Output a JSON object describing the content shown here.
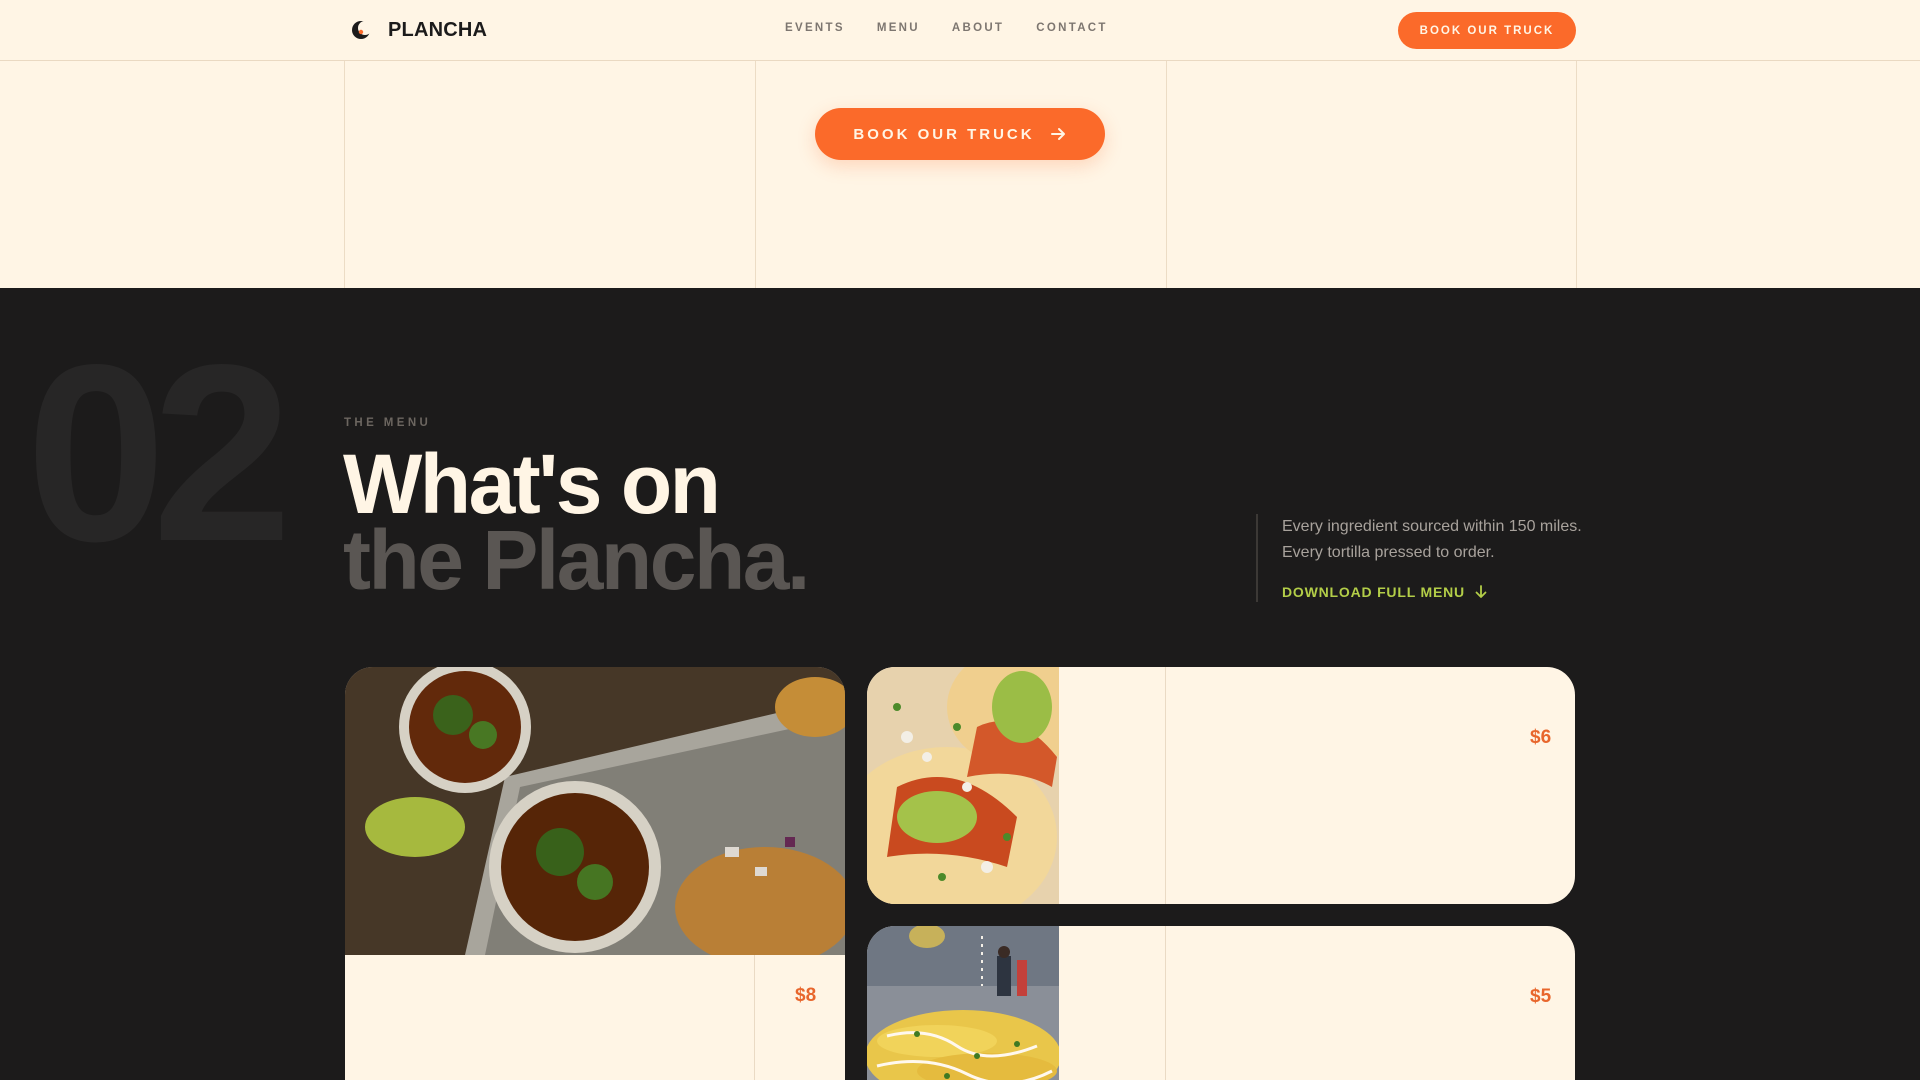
{
  "header": {
    "brand": "PLANCHA",
    "nav": [
      {
        "label": "EVENTS",
        "name": "nav-events"
      },
      {
        "label": "MENU",
        "name": "nav-menu"
      },
      {
        "label": "ABOUT",
        "name": "nav-about"
      },
      {
        "label": "CONTACT",
        "name": "nav-contact"
      }
    ],
    "cta_label": "BOOK OUR TRUCK"
  },
  "hero": {
    "cta_label": "BOOK OUR TRUCK"
  },
  "menu_section": {
    "number": "02",
    "eyebrow": "THE MENU",
    "headline_line1": "What's on",
    "headline_line2": "the Plancha.",
    "description": "Every ingredient sourced within 150 miles. Every tortilla pressed to order.",
    "download_label": "DOWNLOAD FULL MENU",
    "items": [
      {
        "price": "$8",
        "icon": "birria-tacos-photo"
      },
      {
        "price": "$6",
        "icon": "al-pastor-tacos-photo"
      },
      {
        "price": "$5",
        "icon": "elote-photo"
      }
    ]
  },
  "colors": {
    "cream": "#fff5e5",
    "dark": "#1c1b1b",
    "accent_orange": "#fb6a2a",
    "accent_lime": "#b3ce48",
    "muted": "#5a5653"
  }
}
